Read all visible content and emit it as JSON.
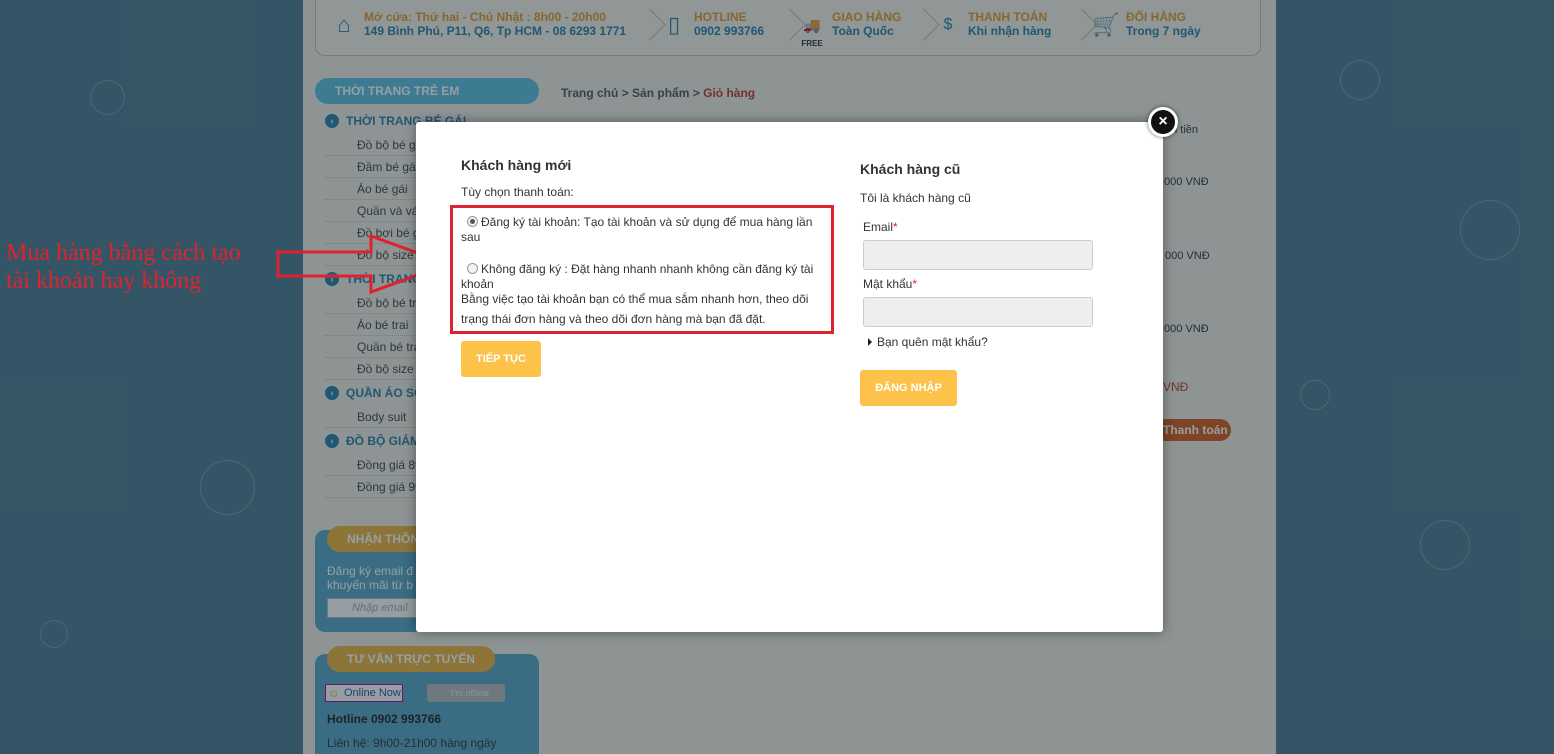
{
  "topbar": {
    "items": [
      {
        "line1": "Mở cửa: Thứ hai - Chủ Nhật : 8h00 - 20h00",
        "line2": "149 Bình Phú, P11, Q6, Tp HCM - 08 6293 1771",
        "icon": "home-icon"
      },
      {
        "line1": "HOTLINE",
        "line2": "0902 993766",
        "icon": "phone-icon"
      },
      {
        "line1": "GIAO HÀNG",
        "line2": "Toàn Quốc",
        "icon": "delivery-truck-icon",
        "badge": "FREE"
      },
      {
        "line1": "THANH TOÁN",
        "line2": "Khi nhận hàng",
        "icon": "payment-hand-icon"
      },
      {
        "line1": "ĐỔI HÀNG",
        "line2": "Trong 7 ngày",
        "icon": "cart-icon"
      }
    ]
  },
  "sidebar": {
    "title": "THỜI TRANG TRẺ EM",
    "categories": [
      {
        "name": "THỜI TRANG BÉ GÁI",
        "subs": [
          "Đồ bộ bé gá",
          "Đầm bé gái",
          "Áo bé gái",
          "Quần và váy",
          "Đồ bơi bé gá",
          "Đồ bộ size l"
        ]
      },
      {
        "name": "THỜI TRANG",
        "subs": [
          "Đồ bộ bé tra",
          "Áo bé trai",
          "Quần bé trai",
          "Đồ bộ size lớ"
        ]
      },
      {
        "name": "QUẦN ÁO SƠ",
        "subs": [
          "Body suit"
        ]
      },
      {
        "name": "ĐỒ BỘ GIẢM",
        "subs": [
          "Đồng giá 89",
          "Đồng giá 99"
        ]
      }
    ],
    "newsletter": {
      "title": "NHẬN THÔN",
      "text1": "Đăng ký email đ",
      "text2": "khuyến mãi từ b",
      "placeholder": "Nhập email"
    },
    "support": {
      "title": "TƯ VẤN TRỰC TUYẾN",
      "online": "Online Now",
      "offline": "I'm offline",
      "hotline": "Hotline 0902 993766",
      "hours": "Liên hệ: 9h00-21h00 hàng ngày"
    }
  },
  "breadcrumb": {
    "home": "Trang chủ",
    "products": "Sản phẩm",
    "current": "Giỏ hàng",
    "sep": ">"
  },
  "cart": {
    "column": "nh tiền",
    "prices": [
      ".000 VNĐ",
      "000 VNĐ",
      ".000 VNĐ"
    ],
    "total": "VNĐ",
    "checkout": "Thanh toán"
  },
  "modal": {
    "close": "×",
    "new_customer": {
      "title": "Khách hàng mới",
      "options_label": "Tùy chọn thanh toán:",
      "register_option": "Đăng ký tài khoản: Tạo tài khoản và sử dụng để mua hàng lần sau",
      "guest_option": "Không đăng ký : Đặt hàng nhanh nhanh không cần đăng ký tài khoản",
      "description": "Bằng việc tạo tài khoản bạn có thể mua sắm nhanh hơn, theo dõi trạng thái đơn hàng và theo dõi đơn hàng mà bạn đã đặt.",
      "continue_button": "TIẾP TỤC"
    },
    "returning_customer": {
      "title": "Khách hàng cũ",
      "subtitle": "Tôi là khách hàng cũ",
      "email_label": "Email",
      "password_label": "Mật khẩu",
      "required_mark": "*",
      "forgot": "Bạn quên mật khẩu?",
      "login_button": "ĐĂNG NHẬP"
    }
  },
  "annotation": {
    "line1": "Mua hàng bằng cách tạo",
    "line2": "tài khoản hay không"
  },
  "colors": {
    "accent": "#fcc24a",
    "highlight": "#e0222e",
    "brand_blue": "#2b7fa8"
  }
}
